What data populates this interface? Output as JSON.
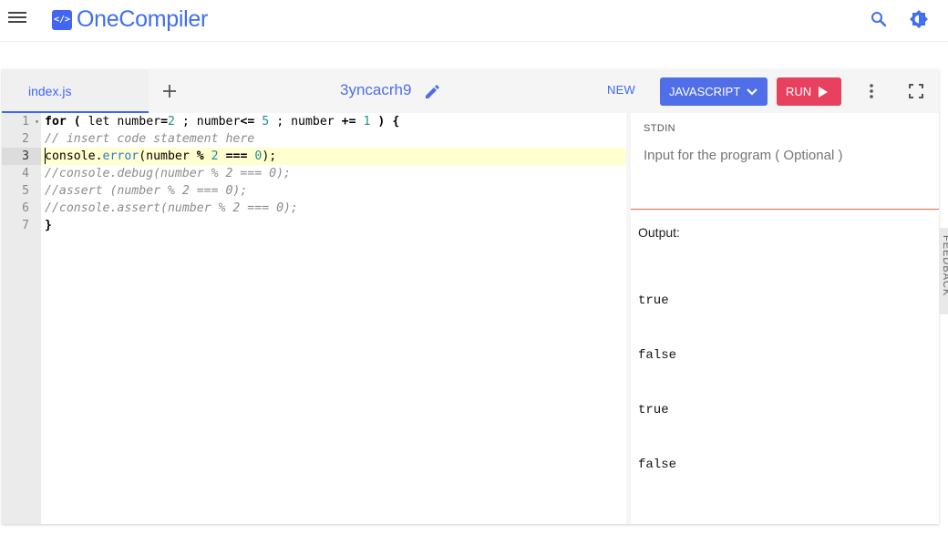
{
  "app": {
    "logo_mark": "</>",
    "name": "OneCompiler"
  },
  "toolbar": {
    "file_tab": "index.js",
    "program_title": "3yncacrh9",
    "new_label": "NEW",
    "language_label": "JAVASCRIPT",
    "run_label": "RUN"
  },
  "editor": {
    "active_line": 3,
    "line_numbers": [
      "1",
      "2",
      "3",
      "4",
      "5",
      "6",
      "7"
    ]
  },
  "stdin": {
    "label": "STDIN",
    "placeholder": "Input for the program ( Optional )"
  },
  "output": {
    "label": "Output:",
    "lines": [
      "true",
      "false",
      "true",
      "false"
    ]
  },
  "feedback_label": "FEEDBACK",
  "colors": {
    "brand": "#4166f5",
    "language_button": "#4f6ee8",
    "run_button": "#e8405f",
    "active_line": "#ffffd0",
    "divider": "#e16d4a"
  },
  "icons": {
    "menu": "menu-icon",
    "search": "search-icon",
    "theme": "brightness-icon",
    "add": "plus-icon",
    "edit": "pencil-icon",
    "language_dropdown": "chevron-down-icon",
    "run": "play-icon",
    "more": "more-vert-icon",
    "fullscreen": "fullscreen-icon"
  }
}
